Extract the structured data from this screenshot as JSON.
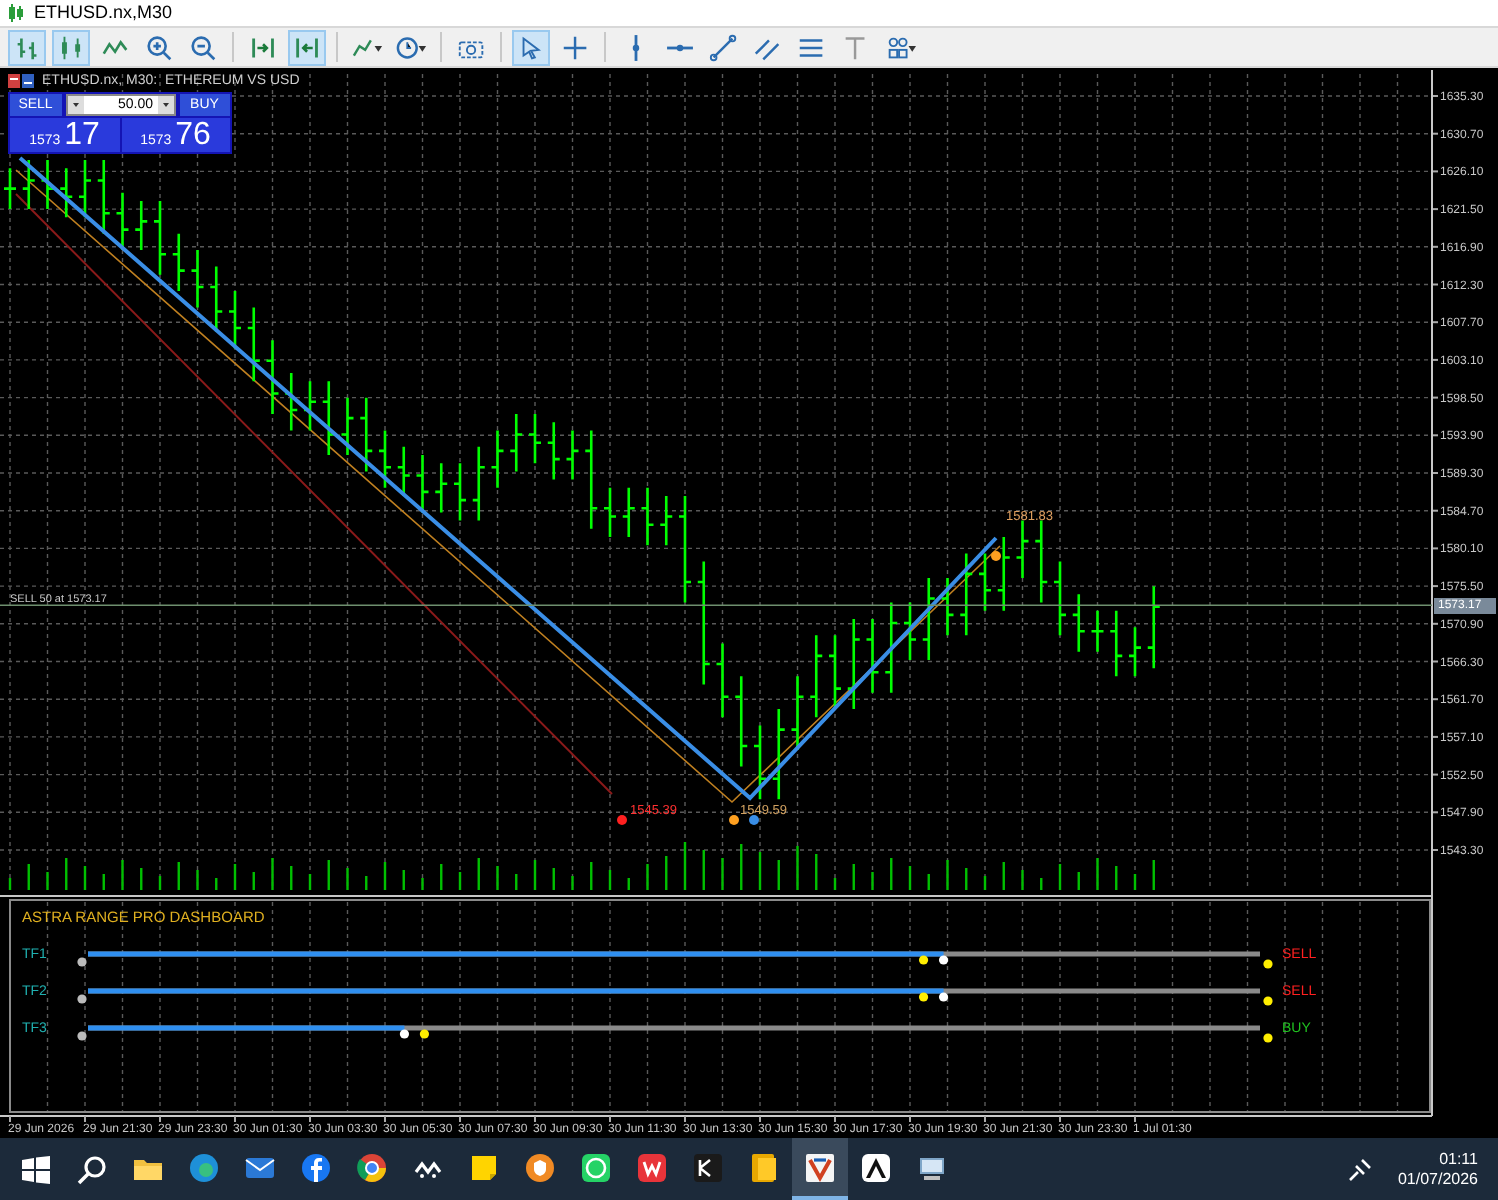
{
  "window": {
    "title": "ETHUSD.nx,M30"
  },
  "toolbar": [
    {
      "selected": true
    },
    {
      "selected": true
    },
    {
      "selected": false
    },
    {
      "selected": false
    },
    {
      "selected": false
    },
    {
      "selected": false
    },
    {
      "selected": true
    },
    {
      "selected": false
    },
    {
      "selected": false
    },
    {
      "selected": false
    },
    {
      "selected": true
    },
    {
      "selected": false
    },
    {
      "selected": false
    },
    {
      "selected": false
    },
    {
      "selected": false
    },
    {
      "selected": false
    },
    {
      "selected": false
    },
    {
      "selected": false
    },
    {
      "selected": false
    }
  ],
  "chart": {
    "title": "ETHUSD.nx, M30:  ETHEREUM VS USD",
    "trade_panel": {
      "sell_label": "SELL",
      "lot": "50.00",
      "buy_label": "BUY",
      "bid_small": "1573",
      "bid_big": "17",
      "ask_small": "1573",
      "ask_big": "76"
    },
    "position_label": "SELL 50 at 1573.17",
    "current_price": "1573.17",
    "price_labels": [
      {
        "text": "1545.39",
        "kind": "low"
      },
      {
        "text": "1549.59",
        "kind": "pivot"
      },
      {
        "text": "1581.83",
        "kind": "high"
      }
    ],
    "price_axis": [
      "1635.30",
      "1630.70",
      "1626.10",
      "1621.50",
      "1616.90",
      "1612.30",
      "1607.70",
      "1603.10",
      "1598.50",
      "1593.90",
      "1589.30",
      "1584.70",
      "1580.10",
      "1575.50",
      "1570.90",
      "1566.30",
      "1561.70",
      "1557.10",
      "1552.50",
      "1547.90",
      "1543.30"
    ],
    "time_axis": [
      "29 Jun 2026",
      "29 Jun 21:30",
      "29 Jun 23:30",
      "30 Jun 01:30",
      "30 Jun 03:30",
      "30 Jun 05:30",
      "30 Jun 07:30",
      "30 Jun 09:30",
      "30 Jun 11:30",
      "30 Jun 13:30",
      "30 Jun 15:30",
      "30 Jun 17:30",
      "30 Jun 19:30",
      "30 Jun 21:30",
      "30 Jun 23:30",
      "1 Jul 01:30"
    ]
  },
  "dashboard": {
    "title": "ASTRA RANGE PRO DASHBOARD",
    "rows": [
      {
        "label": "TF1",
        "level": 0.73,
        "signal": "SELL",
        "kind": "sell"
      },
      {
        "label": "TF2",
        "level": 0.73,
        "signal": "SELL",
        "kind": "sell"
      },
      {
        "label": "TF3",
        "level": 0.27,
        "signal": "BUY",
        "kind": "buy"
      }
    ]
  },
  "taskbar": {
    "apps": [
      {
        "selected": false
      },
      {
        "selected": false
      },
      {
        "selected": false
      },
      {
        "selected": false
      },
      {
        "selected": false
      },
      {
        "selected": false
      },
      {
        "selected": false
      },
      {
        "selected": false
      },
      {
        "selected": false
      },
      {
        "selected": false
      },
      {
        "selected": false
      },
      {
        "selected": false
      },
      {
        "selected": true
      },
      {
        "selected": false
      },
      {
        "selected": false
      }
    ],
    "time": "01:11",
    "date": "01/07/2026"
  }
}
